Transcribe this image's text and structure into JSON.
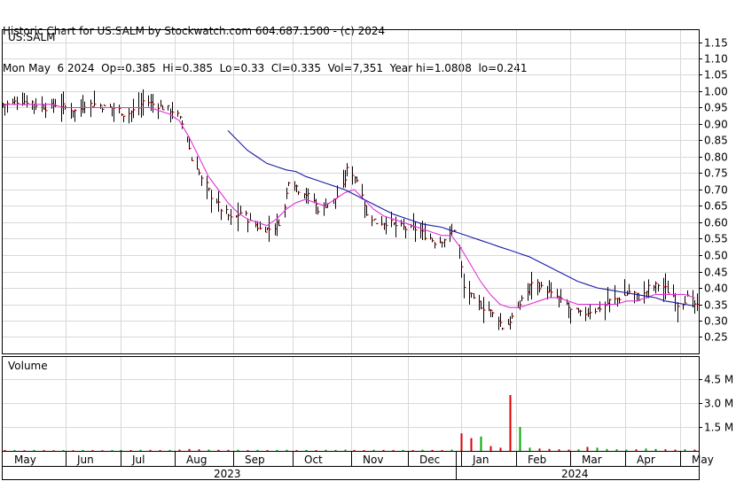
{
  "header": {
    "line1": "Historic Chart for US:SALM by Stockwatch.com 604.687.1500 - (c) 2024",
    "line2": "Mon May  6 2024  Op=0.385  Hi=0.385  Lo=0.33  Cl=0.335  Vol=7,351  Year hi=1.0808  lo=0.241"
  },
  "price_panel": {
    "label": "US:SALM"
  },
  "volume_panel": {
    "label": "Volume"
  },
  "colors": {
    "bar": "#000000",
    "close_tick": "#cc0000",
    "ma_short": "#dd33dd",
    "ma_long": "#1a1aa6",
    "vol_up": "#00aa00",
    "vol_down": "#dd0000",
    "grid": "#d8d8d8",
    "frame": "#000000"
  },
  "chart_data": [
    {
      "type": "ohlc",
      "title": "US:SALM",
      "ylim": [
        0.2,
        1.18
      ],
      "yticks": [
        0.25,
        0.3,
        0.35,
        0.4,
        0.45,
        0.5,
        0.55,
        0.6,
        0.65,
        0.7,
        0.75,
        0.8,
        0.85,
        0.9,
        0.95,
        1.0,
        1.05,
        1.1,
        1.15
      ],
      "ytick_labels": [
        "0.25",
        "0.30",
        "0.35",
        "0.40",
        "0.45",
        "0.50",
        "0.55",
        "0.60",
        "0.65",
        "0.70",
        "0.75",
        "0.80",
        "0.85",
        "0.90",
        "0.95",
        "1.00",
        "1.05",
        "1.10",
        "1.15"
      ],
      "x_months": [
        "May",
        "Jun",
        "Jul",
        "Aug",
        "Sep",
        "Oct",
        "Nov",
        "Dec",
        "Jan",
        "Feb",
        "Mar",
        "Apr",
        "May"
      ],
      "x_years": [
        "2023",
        "2024"
      ],
      "grid": true,
      "weekly_close": [
        0.96,
        0.97,
        0.97,
        0.96,
        0.95,
        0.96,
        0.95,
        0.94,
        0.96,
        0.96,
        0.95,
        0.95,
        0.93,
        0.94,
        0.97,
        0.96,
        0.95,
        0.94,
        0.9,
        0.79,
        0.73,
        0.68,
        0.64,
        0.61,
        0.63,
        0.6,
        0.58,
        0.58,
        0.6,
        0.73,
        0.7,
        0.68,
        0.64,
        0.66,
        0.68,
        0.76,
        0.73,
        0.62,
        0.6,
        0.6,
        0.59,
        0.58,
        0.58,
        0.56,
        0.54,
        0.55,
        0.58,
        0.4,
        0.36,
        0.34,
        0.32,
        0.28,
        0.31,
        0.37,
        0.42,
        0.4,
        0.38,
        0.36,
        0.33,
        0.32,
        0.33,
        0.34,
        0.36,
        0.37,
        0.39,
        0.37,
        0.4,
        0.41,
        0.39,
        0.35,
        0.37,
        0.34
      ],
      "ma_short": {
        "start_week": 0,
        "values": [
          0.96,
          0.96,
          0.96,
          0.96,
          0.96,
          0.96,
          0.95,
          0.95,
          0.95,
          0.95,
          0.95,
          0.95,
          0.95,
          0.95,
          0.95,
          0.95,
          0.94,
          0.93,
          0.91,
          0.86,
          0.8,
          0.74,
          0.7,
          0.66,
          0.63,
          0.61,
          0.6,
          0.59,
          0.61,
          0.64,
          0.66,
          0.67,
          0.66,
          0.65,
          0.67,
          0.69,
          0.7,
          0.67,
          0.64,
          0.62,
          0.61,
          0.6,
          0.59,
          0.58,
          0.57,
          0.56,
          0.56,
          0.52,
          0.47,
          0.42,
          0.38,
          0.35,
          0.34,
          0.34,
          0.35,
          0.36,
          0.37,
          0.37,
          0.36,
          0.35,
          0.35,
          0.35,
          0.35,
          0.35,
          0.36,
          0.36,
          0.37,
          0.38,
          0.38,
          0.38,
          0.38,
          0.37
        ]
      },
      "ma_long": {
        "start_week": 23,
        "values": [
          0.88,
          0.85,
          0.82,
          0.8,
          0.78,
          0.77,
          0.76,
          0.755,
          0.74,
          0.73,
          0.72,
          0.71,
          0.7,
          0.685,
          0.67,
          0.655,
          0.64,
          0.625,
          0.615,
          0.605,
          0.595,
          0.59,
          0.585,
          0.575,
          0.565,
          0.555,
          0.545,
          0.535,
          0.525,
          0.515,
          0.505,
          0.495,
          0.48,
          0.465,
          0.45,
          0.435,
          0.42,
          0.41,
          0.4,
          0.395,
          0.39,
          0.385,
          0.38,
          0.375,
          0.37,
          0.36,
          0.355,
          0.35,
          0.345
        ]
      }
    },
    {
      "type": "bar",
      "title": "Volume",
      "ylim": [
        0,
        5.2
      ],
      "yticks": [
        1.5,
        3.0,
        4.5
      ],
      "ytick_labels": [
        "1.5 M",
        "3.0 M",
        "4.5 M"
      ],
      "unit": "M",
      "weekly_volume": [
        0.06,
        0.05,
        0.04,
        0.06,
        0.05,
        0.04,
        0.05,
        0.04,
        0.06,
        0.05,
        0.04,
        0.05,
        0.06,
        0.05,
        0.07,
        0.06,
        0.05,
        0.06,
        0.08,
        0.12,
        0.1,
        0.08,
        0.07,
        0.06,
        0.07,
        0.05,
        0.06,
        0.05,
        0.06,
        0.07,
        0.05,
        0.06,
        0.05,
        0.07,
        0.06,
        0.08,
        0.06,
        0.05,
        0.07,
        0.06,
        0.05,
        0.06,
        0.05,
        0.07,
        0.06,
        0.05,
        0.08,
        1.1,
        0.8,
        0.9,
        0.3,
        0.2,
        3.5,
        1.5,
        0.2,
        0.15,
        0.12,
        0.1,
        0.08,
        0.1,
        0.25,
        0.2,
        0.12,
        0.1,
        0.08,
        0.1,
        0.15,
        0.12,
        0.1,
        0.08,
        0.1,
        0.08
      ],
      "volume_up": [
        false,
        true,
        false,
        true,
        false,
        false,
        true,
        false,
        true,
        false,
        false,
        true,
        true,
        false,
        true,
        false,
        false,
        true,
        false,
        false,
        false,
        true,
        false,
        false,
        true,
        false,
        true,
        false,
        true,
        true,
        false,
        true,
        false,
        true,
        true,
        true,
        false,
        false,
        true,
        false,
        false,
        true,
        false,
        true,
        false,
        false,
        true,
        false,
        false,
        true,
        false,
        false,
        false,
        true,
        true,
        false,
        false,
        false,
        false,
        true,
        false,
        true,
        true,
        true,
        true,
        false,
        true,
        true,
        false,
        false,
        true,
        false
      ]
    }
  ]
}
